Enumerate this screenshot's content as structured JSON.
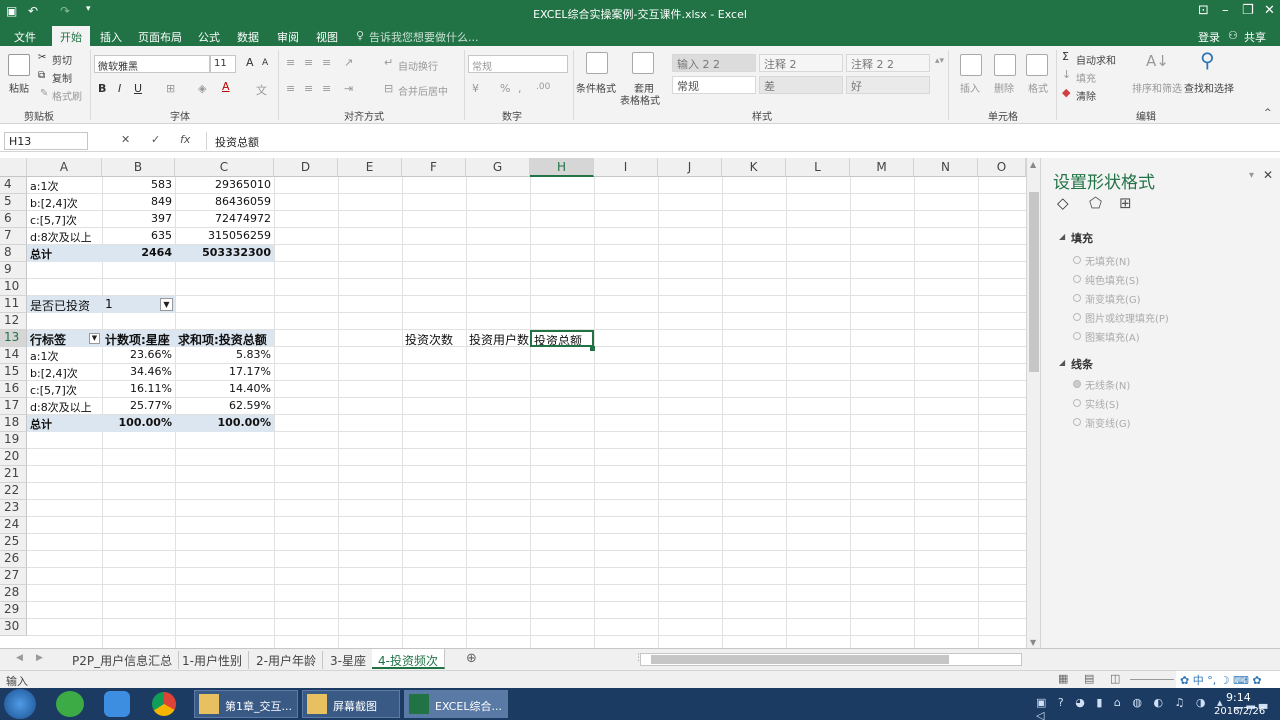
{
  "window": {
    "title": "EXCEL综合实操案例-交互课件.xlsx - Excel"
  },
  "account": {
    "login": "登录",
    "share": "共享"
  },
  "tabs": [
    {
      "label": "文件"
    },
    {
      "label": "开始"
    },
    {
      "label": "插入"
    },
    {
      "label": "页面布局"
    },
    {
      "label": "公式"
    },
    {
      "label": "数据"
    },
    {
      "label": "审阅"
    },
    {
      "label": "视图"
    }
  ],
  "tell_me": "告诉我您想要做什么...",
  "ribbon": {
    "clipboard": {
      "paste": "粘贴",
      "cut": "剪切",
      "copy": "复制",
      "format_painter": "格式刷",
      "group": "剪贴板"
    },
    "font": {
      "name": "微软雅黑",
      "size": "11",
      "group": "字体"
    },
    "align": {
      "wrap": "自动换行",
      "merge": "合并后居中",
      "group": "对齐方式"
    },
    "number": {
      "format": "常规",
      "group": "数字"
    },
    "styles": {
      "cond": "条件格式",
      "table_l1": "套用",
      "table_l2": "表格格式",
      "cells": [
        "输入 2 2",
        "注释 2",
        "注释 2 2",
        "常规",
        "差",
        "好"
      ],
      "group": "样式"
    },
    "cells": {
      "insert": "插入",
      "delete": "删除",
      "format": "格式",
      "group": "单元格"
    },
    "editing": {
      "autosum": "自动求和",
      "fill": "填充",
      "clear": "清除",
      "sort": "排序和筛选",
      "find": "查找和选择",
      "group": "编辑"
    }
  },
  "formula_bar": {
    "name_box": "H13",
    "content": "投资总额"
  },
  "columns": [
    "A",
    "B",
    "C",
    "D",
    "E",
    "F",
    "G",
    "H",
    "I",
    "J",
    "K",
    "L",
    "M",
    "N",
    "O"
  ],
  "rows": [
    "4",
    "5",
    "6",
    "7",
    "8",
    "9",
    "10",
    "11",
    "12",
    "13",
    "14",
    "15",
    "16",
    "17",
    "18",
    "19",
    "20",
    "21",
    "22",
    "23",
    "24",
    "25",
    "26",
    "27",
    "28",
    "29",
    "30"
  ],
  "table1": [
    [
      "a:1次",
      "583",
      "29365010"
    ],
    [
      "b:[2,4]次",
      "849",
      "86436059"
    ],
    [
      "c:[5,7]次",
      "397",
      "72474972"
    ],
    [
      "d:8次及以上",
      "635",
      "315056259"
    ],
    [
      "总计",
      "2464",
      "503332300"
    ]
  ],
  "filter": {
    "label": "是否已投资",
    "value": "1"
  },
  "pivot": {
    "headers": [
      "行标签",
      "计数项:星座",
      "求和项:投资总额"
    ],
    "rows": [
      [
        "a:1次",
        "23.66%",
        "5.83%"
      ],
      [
        "b:[2,4]次",
        "34.46%",
        "17.17%"
      ],
      [
        "c:[5,7]次",
        "16.11%",
        "14.40%"
      ],
      [
        "d:8次及以上",
        "25.77%",
        "62.59%"
      ],
      [
        "总计",
        "100.00%",
        "100.00%"
      ]
    ]
  },
  "row13": {
    "F": "投资次数",
    "G": "投资用户数",
    "H": "投资总额"
  },
  "pane": {
    "title": "设置形状格式",
    "fill_section": "填充",
    "fill_options": [
      "无填充(N)",
      "纯色填充(S)",
      "渐变填充(G)",
      "图片或纹理填充(P)",
      "图案填充(A)"
    ],
    "line_section": "线条",
    "line_options": [
      "无线条(N)",
      "实线(S)",
      "渐变线(G)"
    ]
  },
  "sheets": [
    "P2P_用户信息汇总",
    "1-用户性别",
    "2-用户年龄",
    "3-星座",
    "4-投资频次"
  ],
  "status": {
    "mode": "输入"
  },
  "taskbar": {
    "items": [
      "第1章_交互...",
      "屏幕截图",
      "EXCEL综合..."
    ],
    "time": "9:14",
    "date": "2016/2/26"
  },
  "colors": {
    "accent": "#217346",
    "pivot_fill": "#dce6f1"
  }
}
